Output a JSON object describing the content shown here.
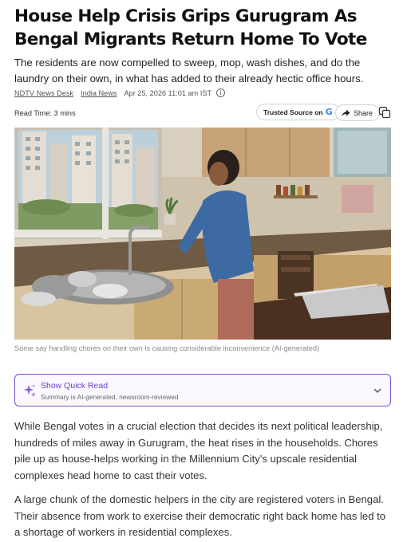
{
  "article": {
    "headline": "House Help Crisis Grips Gurugram As Bengal Migrants Return Home To Vote",
    "standfirst": "The residents are now compelled to sweep, mop, wash dishes, and do the laundry on their own, in what has added to their already hectic office hours.",
    "byline": {
      "author": "NDTV News Desk",
      "category": "India News",
      "date": "Apr 25, 2026 11:01 am IST",
      "info_icon": "info-icon"
    },
    "read_time": "Read Time: 3 mins",
    "actions": {
      "trusted_label": "Trusted Source on",
      "trusted_mark": "G",
      "share_label": "Share",
      "share_icon": "share-arrow-icon",
      "copy_icon": "copy-link-icon"
    },
    "image": {
      "caption": "Some say handling chores on their own is causing considerable inconvenience (AI-generated)"
    },
    "quick_read": {
      "title": "Show Quick Read",
      "subtitle": "Summary is AI-generated, newsroom-reviewed",
      "icon": "sparkle-icon",
      "chevron": "chevron-down-icon"
    },
    "paragraphs": [
      "While Bengal votes in a crucial election that decides its next political leadership, hundreds of miles away in Gurugram, the heat rises in the households. Chores pile up as house-helps working in the Millennium City's upscale residential complexes head home to cast their votes.",
      "A large chunk of the domestic helpers in the city are registered voters in Bengal. Their absence from work to exercise their democratic right back home has led to a shortage of workers in residential complexes."
    ]
  },
  "colors": {
    "accent_purple": "#7b4fd1",
    "quick_read_text": "#6a3ec6",
    "text_primary": "#111111",
    "text_muted": "#8a8a8a"
  }
}
